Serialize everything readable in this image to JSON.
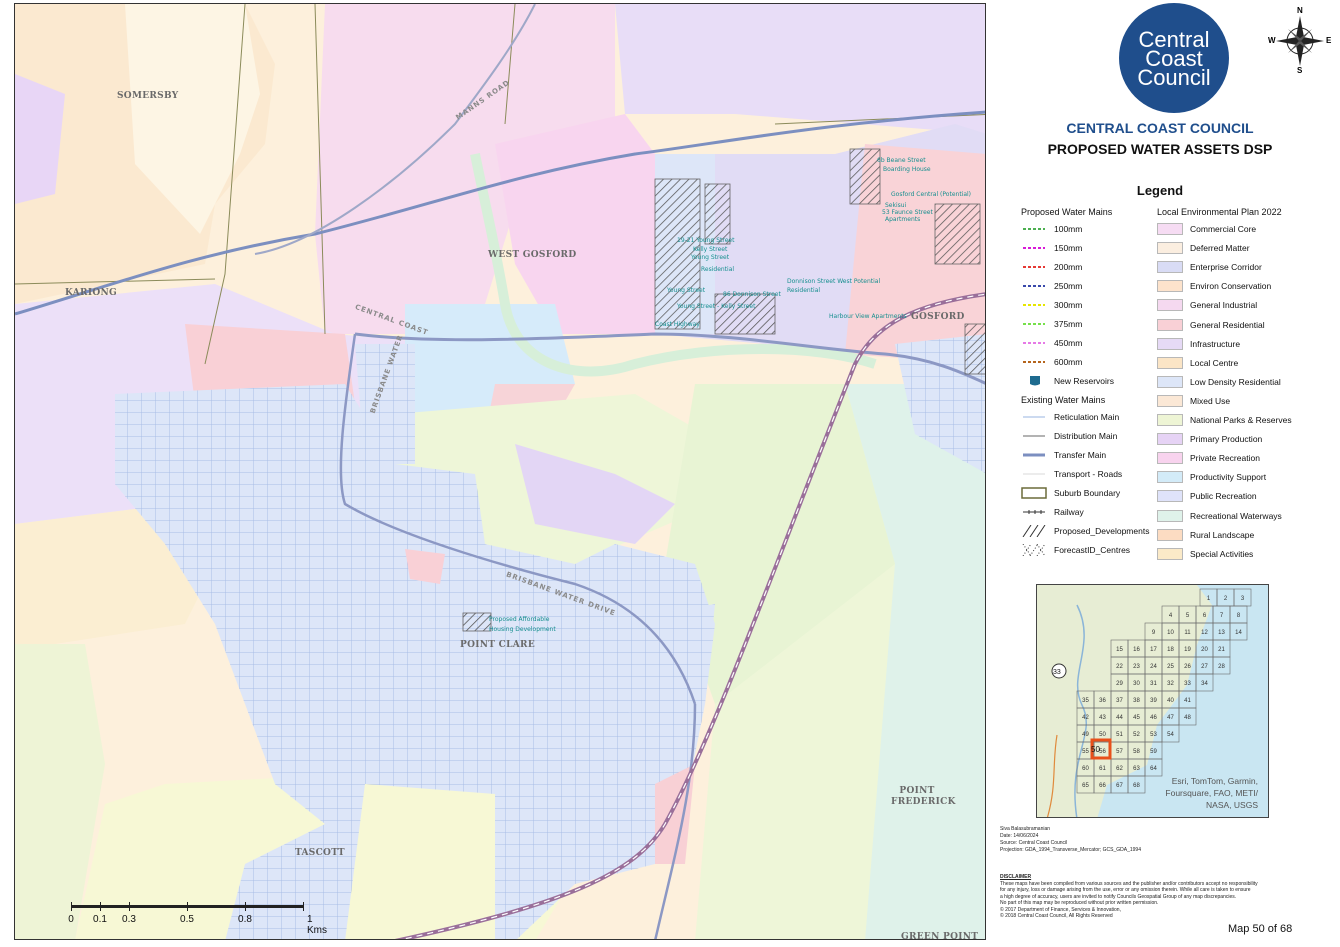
{
  "map": {
    "suburbs": {
      "somersby": "SOMERSBY",
      "kariong": "KARIONG",
      "west_gosford": "WEST GOSFORD",
      "gosford": "GOSFORD",
      "point_clare": "POINT CLARE",
      "point_frederick": "POINT FREDERICK",
      "tascott": "TASCOTT",
      "green_point": "GREEN POINT"
    },
    "roads": {
      "manns": "MANNS ROAD",
      "central_coast_hwy": "CENTRAL COAST",
      "brisbane_water_upper": "BRISBANE WATER",
      "brisbane_water_lower": "BRISBANE WATER DRIVE"
    },
    "developments": [
      "6b Beane Street",
      "Boarding House",
      "Gosford Central (Potential)",
      "Sekisui",
      "53 Faunce Street",
      "Apartments",
      "19-21 Young Street",
      "Kelly Street",
      "Young Street",
      "Residential",
      "86 Donnison Street",
      "Donnison Street West Potential",
      "Residential",
      "Young Street",
      "Young Street - Kelly Street",
      "Coast Highway",
      "Harbour View Apartments",
      "Proposed Affordable",
      "Housing Development"
    ],
    "scale_labels": [
      "0",
      "0.1",
      "0.3",
      "0.5",
      "0.8",
      "1 Kms"
    ]
  },
  "panel": {
    "logo_lines": [
      "Central",
      "Coast",
      "Council"
    ],
    "compass": {
      "n": "N",
      "s": "S",
      "e": "E",
      "w": "W"
    },
    "title_org": "CENTRAL COAST COUNCIL",
    "title_sub": "PROPOSED WATER ASSETS DSP",
    "legend_title": "Legend",
    "proposed_mains_head": "Proposed Water Mains",
    "proposed_mains": [
      {
        "label": "100mm",
        "color": "#4caf50"
      },
      {
        "label": "150mm",
        "color": "#d81bd8"
      },
      {
        "label": "200mm",
        "color": "#e53935"
      },
      {
        "label": "250mm",
        "color": "#3949ab"
      },
      {
        "label": "300mm",
        "color": "#e6e600"
      },
      {
        "label": "375mm",
        "color": "#76e04a"
      },
      {
        "label": "450mm",
        "color": "#e67ae6"
      },
      {
        "label": "600mm",
        "color": "#b5651d"
      }
    ],
    "new_reservoirs": "New Reservoirs",
    "existing_head": "Existing Water Mains",
    "existing": [
      {
        "label": "Reticulation Main",
        "color": "#9ab6e0"
      },
      {
        "label": "Distribution Main",
        "color": "#b3b3b3"
      },
      {
        "label": "Transfer Main",
        "color": "#7c8fc0"
      },
      {
        "label": "Transport - Roads",
        "color": "#d8d8d8"
      }
    ],
    "suburb_boundary": "Suburb Boundary",
    "railway": "Railway",
    "proposed_dev": "Proposed_Developments",
    "forecast": "ForecastID_Centres",
    "lep_head": "Local Environmental Plan 2022",
    "lep": [
      {
        "label": "Commercial Core",
        "color": "#f6dcf3"
      },
      {
        "label": "Deferred Matter",
        "color": "#fbeee0"
      },
      {
        "label": "Enterprise Corridor",
        "color": "#d9dcf5"
      },
      {
        "label": "Environ Conservation",
        "color": "#fde3cc"
      },
      {
        "label": "General Industrial",
        "color": "#f5d9f0"
      },
      {
        "label": "General Residential",
        "color": "#f9d0d6"
      },
      {
        "label": "Infrastructure",
        "color": "#e6daf6"
      },
      {
        "label": "Local Centre",
        "color": "#fbe5c6"
      },
      {
        "label": "Low Density Residential",
        "color": "#dde6f8"
      },
      {
        "label": "Mixed Use",
        "color": "#fbe8d6"
      },
      {
        "label": "National Parks & Reserves",
        "color": "#eef5d5"
      },
      {
        "label": "Primary Production",
        "color": "#e6d3f5"
      },
      {
        "label": "Private Recreation",
        "color": "#f8d3ee"
      },
      {
        "label": "Productivity Support",
        "color": "#d3ebf8"
      },
      {
        "label": "Public Recreation",
        "color": "#dfe3fa"
      },
      {
        "label": "Recreational Waterways",
        "color": "#dff2ea"
      },
      {
        "label": "Rural Landscape",
        "color": "#fcdcc2"
      },
      {
        "label": "Special Activities",
        "color": "#fbeac8"
      }
    ],
    "index_credit": [
      "Esri, TomTom, Garmin,",
      "Foursquare, FAO, METI/",
      "NASA, USGS"
    ],
    "index_road": "33",
    "index_current": "50",
    "meta_lines": [
      "Siva Balasubramanian",
      "Date: 14/06/2024",
      "Source: Central Coast Council",
      "Projection: GDA_1994_Transverse_Mercator; GCS_GDA_1994"
    ],
    "disclaimer_head": "DISCLAIMER",
    "disclaimer_lines": [
      "These maps have been compiled from various sources and the publisher and/or contributors accept no responsibility",
      "for any injury, loss or damage arising from the use, error or any omission therein. While all care is taken to ensure",
      "a high degree of accuracy, users are invited to notify Councils Geospatial Group of any map discrepancies.",
      "No part of this map may be reproduced without prior written permission.",
      "© 2017 Department of Finance, Services & Innovation,",
      "© 2018 Central Coast Council, All Rights Reserved"
    ],
    "page": "Map 50 of 68"
  }
}
